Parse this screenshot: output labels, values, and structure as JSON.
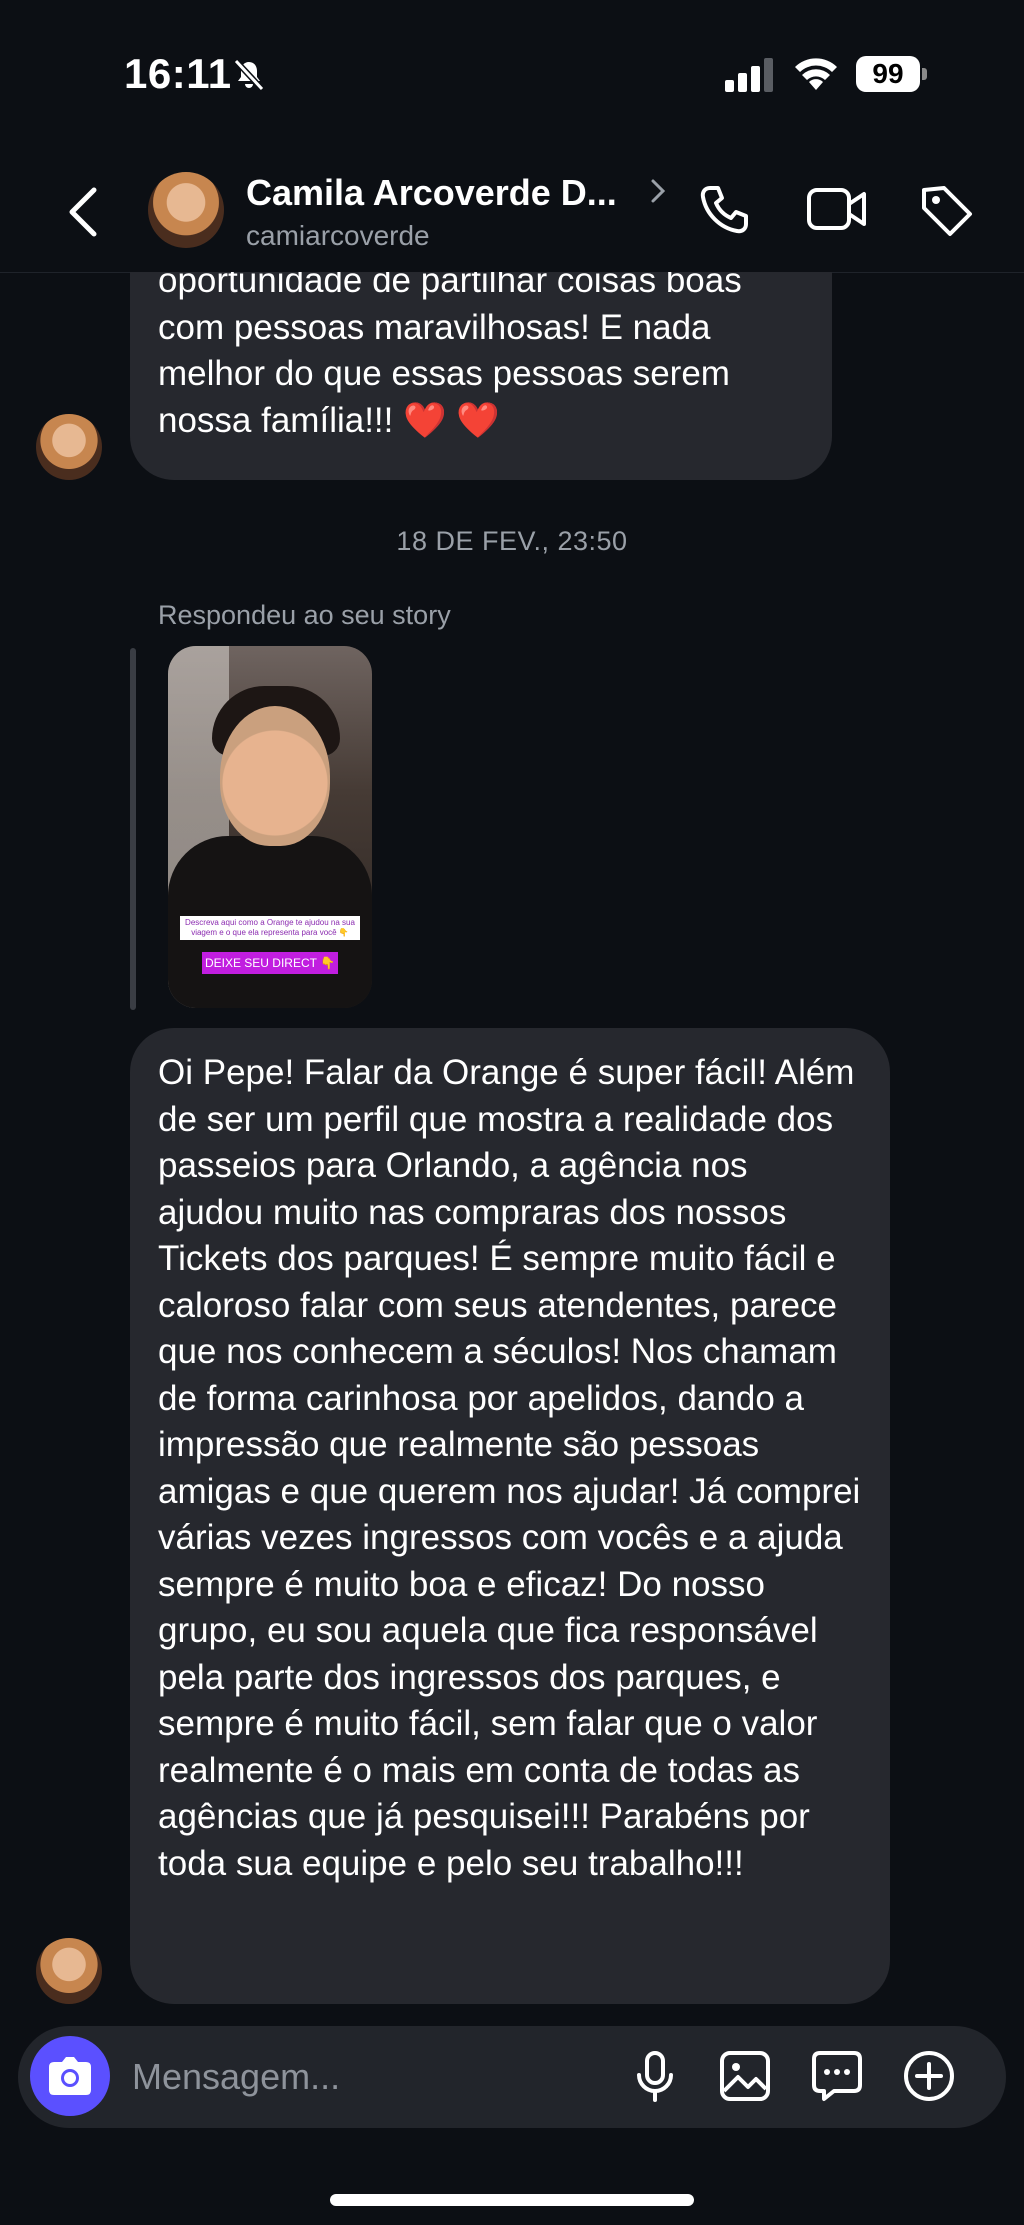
{
  "status_bar": {
    "time": "16:11",
    "battery": "99"
  },
  "header": {
    "name": "Camila Arcoverde D...",
    "username": "camiarcoverde"
  },
  "messages": {
    "first": {
      "text": "oportunidade de partilhar coisas boas com pessoas maravilhosas! E nada melhor do que essas pessoas serem nossa família!!! ❤️ ❤️"
    },
    "date_separator": "18 DE FEV., 23:50",
    "story_reply_label": "Respondeu ao seu story",
    "story": {
      "caption": "Descreva aqui como a Orange te ajudou na sua viagem e o que ela representa para você 👇",
      "cta": "DEIXE SEU DIRECT 👇"
    },
    "second": {
      "text": "Oi Pepe! Falar da Orange é super fácil! Além de ser um perfil que mostra a realidade dos passeios para Orlando, a agência nos ajudou muito nas compraras dos nossos Tickets dos parques! É sempre muito fácil e caloroso falar com seus atendentes, parece que nos conhecem a séculos! Nos chamam de forma carinhosa por apelidos, dando a impressão que realmente são pessoas amigas e que querem nos ajudar! Já comprei várias vezes ingressos com vocês e a ajuda sempre é muito boa e eficaz! Do nosso grupo, eu sou aquela que fica responsável pela parte dos ingressos dos parques, e sempre é muito fácil, sem falar que o valor realmente é o mais em conta de todas as agências que já pesquisei!!! Parabéns por toda sua equipe e pelo seu trabalho!!!"
    }
  },
  "composer": {
    "placeholder": "Mensagem..."
  },
  "colors": {
    "background": "#0c0f14",
    "bubble": "#26282e",
    "camera_button": "#5b50ff",
    "muted_text": "#9aa0a8"
  }
}
